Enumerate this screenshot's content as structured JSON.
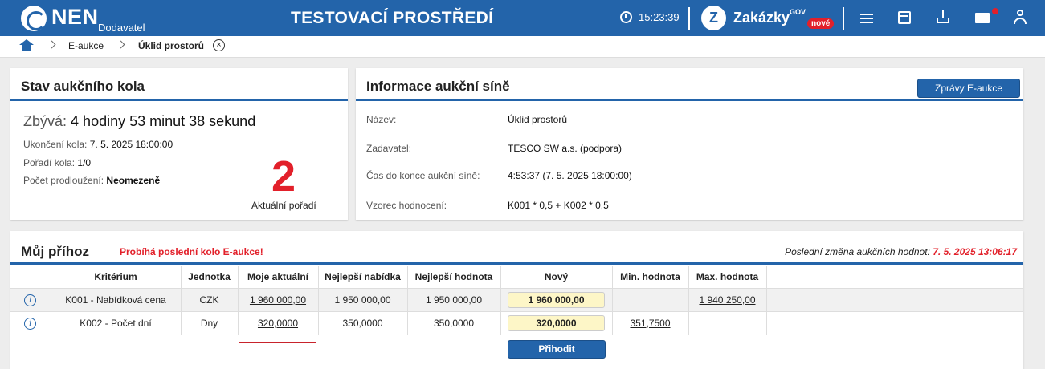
{
  "topbar": {
    "logo_text": "NEN",
    "logo_sub": "Dodavatel",
    "env_title": "TESTOVACÍ PROSTŘEDÍ",
    "time": "15:23:39",
    "zakazky": "Zakázky",
    "gov": "GOV",
    "new_badge": "nové"
  },
  "breadcrumb": {
    "items": [
      "E-aukce",
      "Úklid prostorů"
    ]
  },
  "round": {
    "title": "Stav aukčního kola",
    "remain_label": "Zbývá:",
    "remain_value": "4 hodiny 53 minut 38 sekund",
    "end_label": "Ukončení kola:",
    "end_value": "7. 5. 2025 18:00:00",
    "order_label": "Pořadí kola:",
    "order_value": "1/0",
    "ext_label": "Počet prodloužení:",
    "ext_value": "Neomezeně",
    "rank": "2",
    "rank_label": "Aktuální pořadí"
  },
  "hall": {
    "title": "Informace aukční síně",
    "button": "Zprávy E-aukce",
    "rows": [
      {
        "k": "Název:",
        "v": "Úklid prostorů"
      },
      {
        "k": "Zadavatel:",
        "v": "TESCO SW a.s. (podpora)"
      },
      {
        "k": "Čas do konce aukční síně:",
        "v": "4:53:37 (7. 5. 2025 18:00:00)"
      },
      {
        "k": "Vzorec hodnocení:",
        "v": "K001 * 0,5 + K002 * 0,5"
      }
    ]
  },
  "bid": {
    "title": "Můj příhoz",
    "warning": "Probíhá poslední kolo E-aukce!",
    "last_change_label": "Poslední změna aukčních hodnot:",
    "last_change_value": "7. 5. 2025 13:06:17",
    "columns": [
      "Kritérium",
      "Jednotka",
      "Moje aktuální",
      "Nejlepší nabídka",
      "Nejlepší hodnota",
      "Nový",
      "Min. hodnota",
      "Max. hodnota"
    ],
    "rows": [
      {
        "criterion": "K001 - Nabídková cena",
        "unit": "CZK",
        "mine": "1 960 000,00",
        "best_offer": "1 950 000,00",
        "best_value": "1 950 000,00",
        "new": "1 960 000,00",
        "min": "",
        "max": "1 940 250,00"
      },
      {
        "criterion": "K002 - Počet dní",
        "unit": "Dny",
        "mine": "320,0000",
        "best_offer": "350,0000",
        "best_value": "350,0000",
        "new": "320,0000",
        "min": "351,7500",
        "max": ""
      }
    ],
    "submit": "Přihodit"
  }
}
